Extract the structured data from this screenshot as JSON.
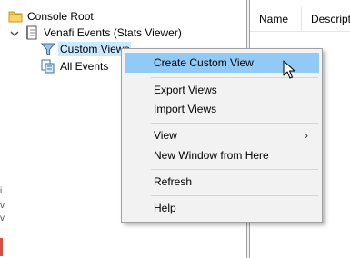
{
  "tree": {
    "console_root": "Console Root",
    "venafi_events": "Venafi Events (Stats Viewer)",
    "custom_views": "Custom Views",
    "all_events": "All Events"
  },
  "list": {
    "columns": [
      "Name",
      "Descriptio"
    ]
  },
  "context_menu": {
    "items": [
      {
        "label": "Create Custom View"
      },
      {
        "label": "Export Views"
      },
      {
        "label": "Import Views"
      },
      {
        "label": "View",
        "submenu_arrow": "›"
      },
      {
        "label": "New Window from Here"
      },
      {
        "label": "Refresh"
      },
      {
        "label": "Help"
      }
    ]
  },
  "colors": {
    "menu_highlight": "#91c9f7",
    "tree_selection": "#cce8ff",
    "menu_background": "#f2f2f2"
  }
}
